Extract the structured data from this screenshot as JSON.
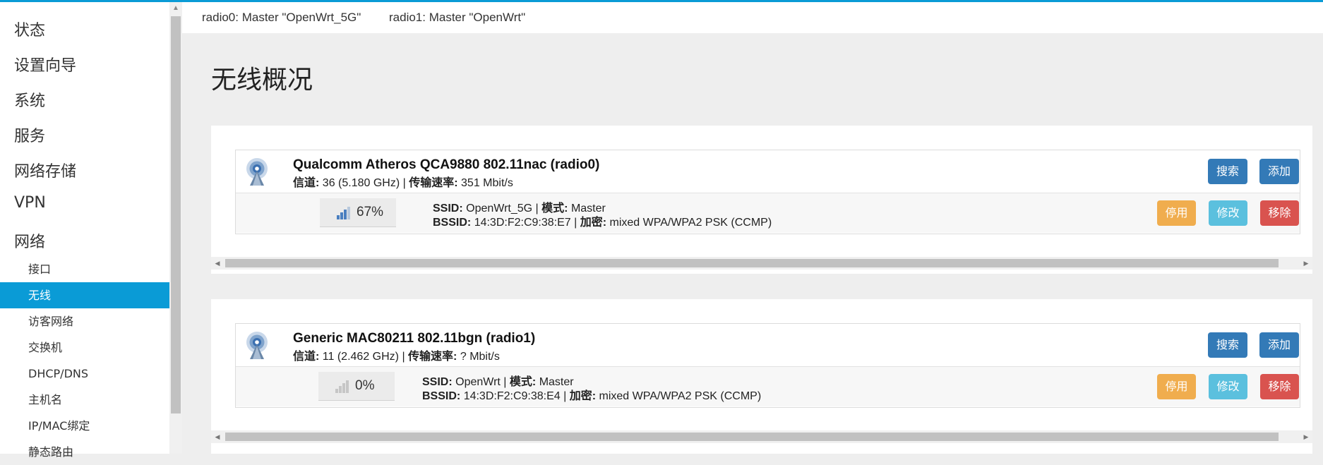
{
  "sidebar": {
    "menu": [
      "状态",
      "设置向导",
      "系统",
      "服务",
      "网络存储",
      "VPN",
      "网络"
    ],
    "submenu": [
      "接口",
      "无线",
      "访客网络",
      "交换机",
      "DHCP/DNS",
      "主机名",
      "IP/MAC绑定",
      "静态路由"
    ],
    "active_submenu": "无线"
  },
  "tabs": [
    "radio0: Master \"OpenWrt_5G\"",
    "radio1: Master \"OpenWrt\""
  ],
  "page_title": "无线概况",
  "buttons": {
    "scan": "搜索",
    "add": "添加",
    "disable": "停用",
    "edit": "修改",
    "remove": "移除"
  },
  "labels": {
    "channel": "信道:",
    "bitrate": "传输速率:",
    "ssid": "SSID:",
    "mode": "模式:",
    "bssid": "BSSID:",
    "encryption": "加密:"
  },
  "radios": [
    {
      "name": "Qualcomm Atheros QCA9880 802.11nac (radio0)",
      "channel": "36 (5.180 GHz)",
      "bitrate": "351 Mbit/s",
      "signal": "67%",
      "ssid": "OpenWrt_5G",
      "mode": "Master",
      "bssid": "14:3D:F2:C9:38:E7",
      "encryption": "mixed WPA/WPA2 PSK (CCMP)"
    },
    {
      "name": "Generic MAC80211 802.11bgn (radio1)",
      "channel": "11 (2.462 GHz)",
      "bitrate": "? Mbit/s",
      "signal": "0%",
      "ssid": "OpenWrt",
      "mode": "Master",
      "bssid": "14:3D:F2:C9:38:E4",
      "encryption": "mixed WPA/WPA2 PSK (CCMP)"
    }
  ],
  "colors": {
    "accent": "#0a9bd6",
    "btn_primary": "#337ab7",
    "btn_warning": "#f0ad4e",
    "btn_info": "#5bc0de",
    "btn_danger": "#d9534f"
  },
  "icons": [
    "wifi-radio-icon",
    "signal-bars-icon"
  ]
}
